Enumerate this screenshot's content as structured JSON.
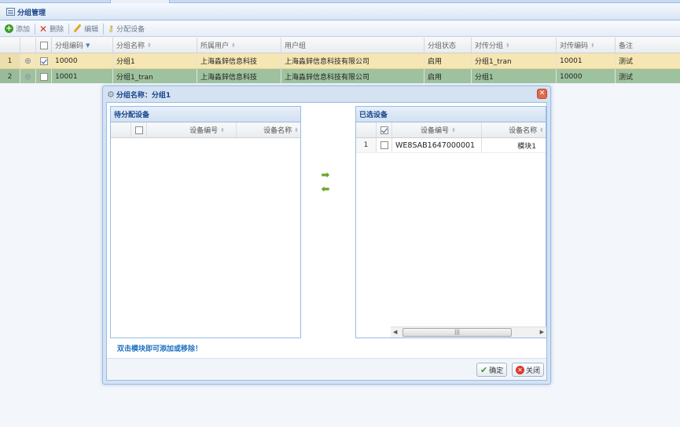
{
  "panel": {
    "title": "分组管理"
  },
  "toolbar": {
    "add": "添加",
    "delete": "删除",
    "edit": "编辑",
    "assign": "分配设备"
  },
  "grid": {
    "columns": [
      "分组编码",
      "分组名称",
      "所属用户",
      "用户组",
      "分组状态",
      "对传分组",
      "对传编码",
      "备注"
    ],
    "rows": [
      {
        "num": "1",
        "checked": true,
        "code": "10000",
        "name": "分组1",
        "user": "上海淼鋅信息科技",
        "usergroup": "上海淼鋅信息科技有限公司",
        "status": "启用",
        "pair_group": "分组1_tran",
        "pair_code": "10001",
        "remark": "测试"
      },
      {
        "num": "2",
        "checked": false,
        "code": "10001",
        "name": "分组1_tran",
        "user": "上海淼鋅信息科技",
        "usergroup": "上海淼鋅信息科技有限公司",
        "status": "启用",
        "pair_group": "分组1",
        "pair_code": "10000",
        "remark": "测试"
      }
    ]
  },
  "dialog": {
    "title": "分组名称：分组1",
    "left": {
      "title": "待分配设备",
      "col_code": "设备编号",
      "col_name": "设备名称"
    },
    "right": {
      "title": "已选设备",
      "col_code": "设备编号",
      "col_name": "设备名称",
      "rows": [
        {
          "num": "1",
          "code": "WE8SAB1647000001",
          "name": "模块1"
        }
      ]
    },
    "hint": "双击模块即可添加或移除！",
    "ok": "确定",
    "close": "关闭"
  },
  "colors": {
    "selected_row": "#f5e6b4",
    "alt_row": "#9ec29e",
    "title_blue": "#15428b"
  }
}
